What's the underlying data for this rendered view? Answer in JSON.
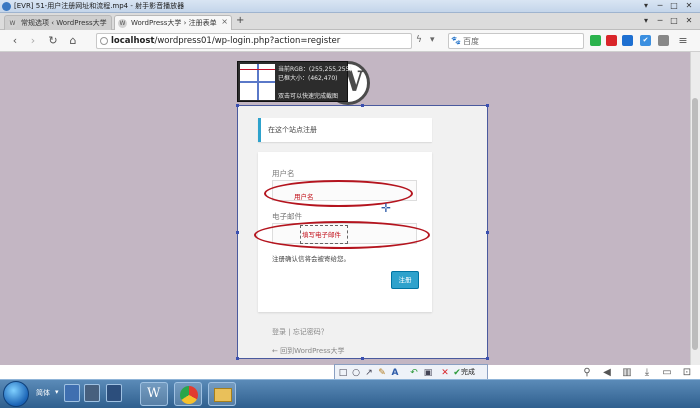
{
  "player": {
    "title": "[EVR] 51-用户注册网址和流程.mp4 - 射手影音播放器",
    "controls": [
      "▾",
      "─",
      "□",
      "✕"
    ]
  },
  "browser": {
    "tabs": [
      {
        "label": "常规选项 ‹ WordPress大学",
        "active": false
      },
      {
        "label": "WordPress大学 › 注册表单",
        "active": true
      }
    ],
    "new_tab": "+",
    "nav": {
      "back": "‹",
      "forward": "›",
      "reload": "↻",
      "home": "⌂"
    },
    "url_host": "localhost",
    "url_path": "/wordpress01/wp-login.php?action=register",
    "search_placeholder": "百度",
    "window_controls": [
      "▾",
      "─",
      "□",
      "✕"
    ]
  },
  "capture": {
    "rgb_label": "当前RGB：(255,255,255)",
    "size_label": "已框大小：(462,470)",
    "hint": "双击可以快速完成截图"
  },
  "wordpress": {
    "logo_letter": "W",
    "notice": "在这个站点注册",
    "username_label": "用户名",
    "email_label": "电子邮件",
    "register_note": "注册确认信将会被寄给您。",
    "register_button": "注册",
    "login_link": "登录",
    "separator": " | ",
    "lost_password_link": "忘记密码？",
    "back_link": "← 回到WordPress大学"
  },
  "annotations": {
    "username": "用户名",
    "email": "填写电子邮件"
  },
  "toolbar": {
    "done_label": "完成",
    "font_size": "12",
    "current_color": "#ff0000",
    "swatches_top": [
      "#000000",
      "#808080",
      "#800000",
      "#808000",
      "#008000",
      "#008080",
      "#000080",
      "#800080"
    ],
    "swatches_bottom": [
      "#ffffff",
      "#c0c0c0",
      "#ff0000",
      "#ffff00",
      "#00ff00",
      "#00ffff",
      "#0000ff",
      "#ff00ff"
    ]
  },
  "taskbar": {
    "lang": "简体"
  }
}
